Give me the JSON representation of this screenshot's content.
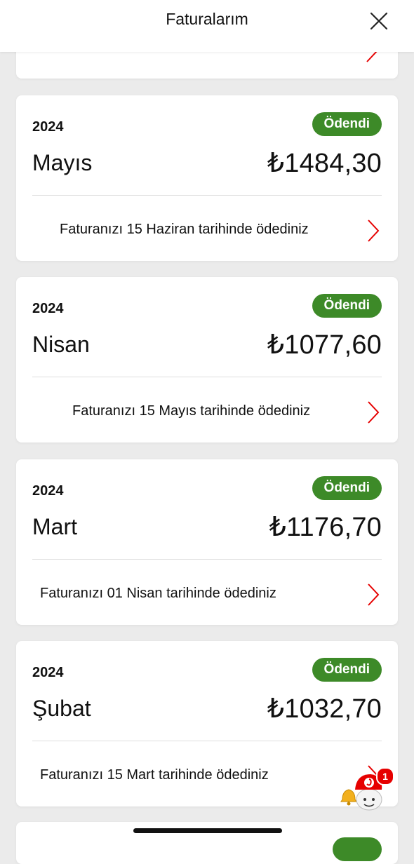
{
  "header": {
    "title": "Faturalarım"
  },
  "invoices": [
    {
      "year": "2024",
      "month": "Mayıs",
      "amount": "₺1484,30",
      "status": "Ödendi",
      "note": "Faturanızı 15 Haziran tarihinde ödediniz"
    },
    {
      "year": "2024",
      "month": "Nisan",
      "amount": "₺1077,60",
      "status": "Ödendi",
      "note": "Faturanızı 15 Mayıs tarihinde ödediniz"
    },
    {
      "year": "2024",
      "month": "Mart",
      "amount": "₺1176,70",
      "status": "Ödendi",
      "note": "Faturanızı 01 Nisan tarihinde ödediniz"
    },
    {
      "year": "2024",
      "month": "Şubat",
      "amount": "₺1032,70",
      "status": "Ödendi",
      "note": "Faturanızı 15 Mart tarihinde ödediniz"
    }
  ],
  "assistant": {
    "notification_count": "1"
  },
  "colors": {
    "paid_badge": "#3d8a28",
    "chevron": "#e60000",
    "brand_red": "#e60000"
  }
}
